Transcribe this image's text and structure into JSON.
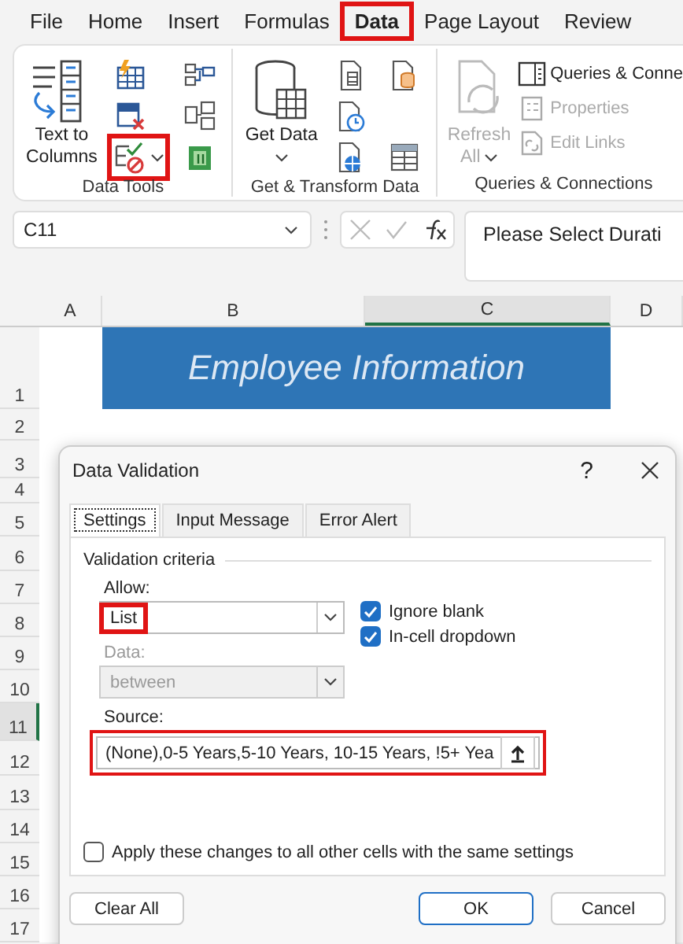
{
  "menu_tabs": [
    {
      "label": "File",
      "selected": false,
      "highlighted": false
    },
    {
      "label": "Home",
      "selected": false,
      "highlighted": false
    },
    {
      "label": "Insert",
      "selected": false,
      "highlighted": false
    },
    {
      "label": "Formulas",
      "selected": false,
      "highlighted": false
    },
    {
      "label": "Data",
      "selected": true,
      "highlighted": true
    },
    {
      "label": "Page Layout",
      "selected": false,
      "highlighted": false
    },
    {
      "label": "Review",
      "selected": false,
      "highlighted": false
    }
  ],
  "ribbon": {
    "groups": [
      {
        "label": "Data Tools",
        "buttons": [
          {
            "kind": "large",
            "label": "Text to Columns",
            "disabled": false,
            "dropdown": false,
            "highlighted": false
          },
          {
            "kind": "icon",
            "highlighted": false,
            "dropdown": false
          },
          {
            "kind": "icon",
            "highlighted": false,
            "dropdown": false
          },
          {
            "kind": "icon",
            "highlighted": true,
            "dropdown": true
          },
          {
            "kind": "icon",
            "highlighted": false,
            "dropdown": false
          },
          {
            "kind": "icon",
            "highlighted": false,
            "dropdown": false
          },
          {
            "kind": "icon",
            "highlighted": false,
            "dropdown": false
          }
        ]
      },
      {
        "label": "Get & Transform Data",
        "buttons": [
          {
            "kind": "large",
            "label": "Get Data",
            "disabled": false,
            "dropdown": true,
            "highlighted": false
          },
          {
            "kind": "icon",
            "highlighted": false,
            "dropdown": false
          },
          {
            "kind": "icon",
            "highlighted": false,
            "dropdown": false
          },
          {
            "kind": "icon",
            "highlighted": false,
            "dropdown": false
          },
          {
            "kind": "icon",
            "highlighted": false,
            "dropdown": false
          },
          {
            "kind": "icon",
            "highlighted": false,
            "dropdown": false
          }
        ]
      },
      {
        "label": "Queries & Connections",
        "buttons": [
          {
            "kind": "large",
            "label": "Refresh All",
            "disabled": true,
            "dropdown": true,
            "highlighted": false
          },
          {
            "kind": "row",
            "label": "Queries & Conne",
            "disabled": false
          },
          {
            "kind": "row",
            "label": "Properties",
            "disabled": true
          },
          {
            "kind": "row",
            "label": "Edit Links",
            "disabled": true
          }
        ]
      }
    ]
  },
  "formula_bar": {
    "name_box": "C11",
    "formula": "Please Select Durati"
  },
  "sheet": {
    "columns": [
      {
        "label": "A",
        "selected": false
      },
      {
        "label": "B",
        "selected": false
      },
      {
        "label": "C",
        "selected": true
      },
      {
        "label": "D",
        "selected": false
      }
    ],
    "rows": [
      {
        "label": "1",
        "selected": false
      },
      {
        "label": "2",
        "selected": false
      },
      {
        "label": "3",
        "selected": false
      },
      {
        "label": "4",
        "selected": false
      },
      {
        "label": "5",
        "selected": false
      },
      {
        "label": "6",
        "selected": false
      },
      {
        "label": "7",
        "selected": false
      },
      {
        "label": "8",
        "selected": false
      },
      {
        "label": "9",
        "selected": false
      },
      {
        "label": "10",
        "selected": false
      },
      {
        "label": "11",
        "selected": true
      },
      {
        "label": "12",
        "selected": false
      },
      {
        "label": "13",
        "selected": false
      },
      {
        "label": "14",
        "selected": false
      },
      {
        "label": "15",
        "selected": false
      },
      {
        "label": "16",
        "selected": false
      },
      {
        "label": "17",
        "selected": false
      }
    ],
    "banner": "Employee Information"
  },
  "dialog": {
    "title": "Data Validation",
    "help": "?",
    "tabs": [
      {
        "label": "Settings",
        "selected": true
      },
      {
        "label": "Input Message",
        "selected": false
      },
      {
        "label": "Error Alert",
        "selected": false
      }
    ],
    "section_label": "Validation criteria",
    "allow": {
      "label": "Allow:",
      "value": "List",
      "highlighted": true
    },
    "data": {
      "label": "Data:",
      "value": "between",
      "disabled": true
    },
    "checkboxes": [
      {
        "label": "Ignore blank",
        "checked": true
      },
      {
        "label": "In-cell dropdown",
        "checked": true
      }
    ],
    "source": {
      "label": "Source:",
      "value": "(None),0-5 Years,5-10 Years, 10-15 Years, !5+ Yea",
      "highlighted": true
    },
    "apply": {
      "label": "Apply these changes to all other cells with the same settings",
      "checked": false
    },
    "buttons": [
      {
        "label": "Clear All",
        "kind": "normal"
      },
      {
        "label": "OK",
        "kind": "default"
      },
      {
        "label": "Cancel",
        "kind": "normal"
      }
    ]
  }
}
